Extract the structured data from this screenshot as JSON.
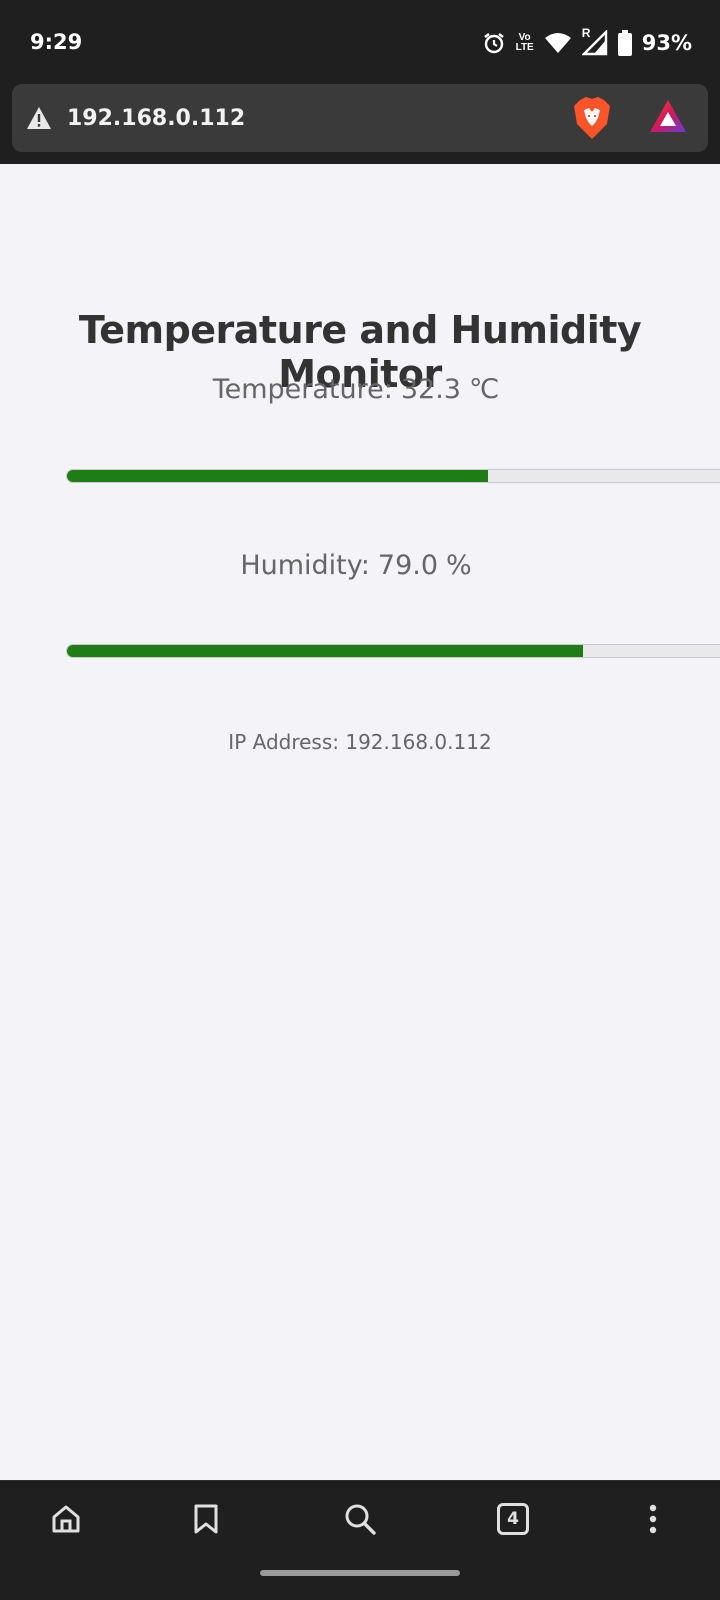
{
  "status_bar": {
    "time": "9:29",
    "icons": [
      "alarm-icon",
      "volte-icon",
      "wifi-icon",
      "signal-icon",
      "battery-icon"
    ],
    "volte_top": "Vo",
    "volte_bottom": "LTE",
    "roaming": "R",
    "battery": "93%"
  },
  "browser": {
    "url": "192.168.0.112",
    "security_icon": "warning-icon"
  },
  "page": {
    "title": "Temperature and Humidity Monitor",
    "temperature": {
      "label": "Temperature:",
      "value": "32.3",
      "unit": "℃",
      "progress": 0.645
    },
    "humidity": {
      "label": "Humidity:",
      "value": "79.0",
      "unit": "%",
      "progress": 0.79
    },
    "ip_line": "IP Address: 192.168.0.112",
    "progress_color": "#1e7e15"
  },
  "toolbar": {
    "tab_count": "4",
    "icons": [
      "home-icon",
      "bookmark-icon",
      "search-icon",
      "tabs-icon",
      "more-icon"
    ]
  }
}
